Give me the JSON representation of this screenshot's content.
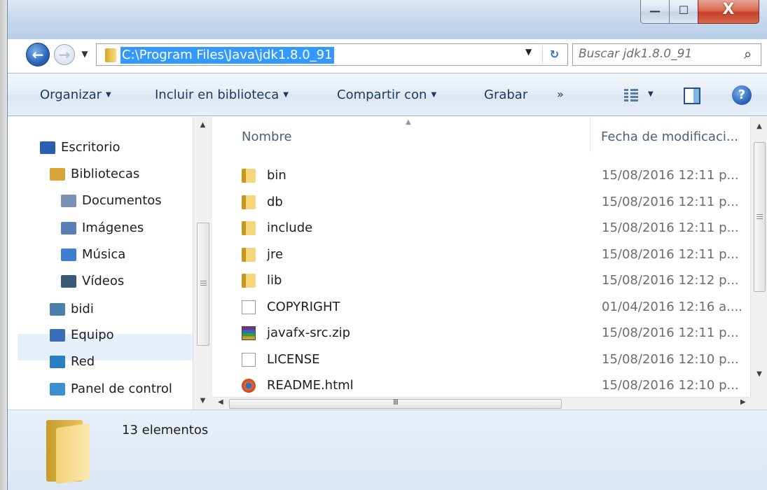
{
  "titlebar": {
    "buttons": {
      "minimize": "—",
      "maximize": "☐",
      "close": "X"
    }
  },
  "nav": {
    "back": "←",
    "forward": "→",
    "address": "C:\\Program Files\\Java\\jdk1.8.0_91",
    "search_placeholder": "Buscar jdk1.8.0_91"
  },
  "commands": {
    "organize": "Organizar",
    "include_library": "Incluir en biblioteca",
    "share_with": "Compartir con",
    "burn": "Grabar",
    "more": "»"
  },
  "navigation_pane": {
    "items": [
      {
        "label": "Escritorio",
        "icon": "desktop-icon",
        "color": "#2a5fb0"
      },
      {
        "label": "Bibliotecas",
        "icon": "libraries-icon",
        "color": "#d9a53a"
      },
      {
        "label": "Documentos",
        "icon": "documents-icon",
        "color": "#7b92b4"
      },
      {
        "label": "Imágenes",
        "icon": "images-icon",
        "color": "#5a7fb8"
      },
      {
        "label": "Música",
        "icon": "music-icon",
        "color": "#3d7fd0"
      },
      {
        "label": "Vídeos",
        "icon": "videos-icon",
        "color": "#3a5a7a"
      },
      {
        "label": "bidi",
        "icon": "user-folder-icon",
        "color": "#4a7fb0"
      },
      {
        "label": "Equipo",
        "icon": "computer-icon",
        "color": "#3a6fb8",
        "selected": true
      },
      {
        "label": "Red",
        "icon": "network-icon",
        "color": "#2a7fc0"
      },
      {
        "label": "Panel de control",
        "icon": "control-panel-icon",
        "color": "#3a8fd0"
      }
    ]
  },
  "file_list": {
    "columns": {
      "name": "Nombre",
      "date": "Fecha de modificaci..."
    },
    "rows": [
      {
        "name": "bin",
        "date": "15/08/2016 12:11 p...",
        "type": "folder"
      },
      {
        "name": "db",
        "date": "15/08/2016 12:11 p...",
        "type": "folder"
      },
      {
        "name": "include",
        "date": "15/08/2016 12:11 p...",
        "type": "folder"
      },
      {
        "name": "jre",
        "date": "15/08/2016 12:11 p...",
        "type": "folder"
      },
      {
        "name": "lib",
        "date": "15/08/2016 12:12 p...",
        "type": "folder"
      },
      {
        "name": "COPYRIGHT",
        "date": "01/04/2016 12:16 a....",
        "type": "file"
      },
      {
        "name": "javafx-src.zip",
        "date": "15/08/2016 12:11 p...",
        "type": "zip"
      },
      {
        "name": "LICENSE",
        "date": "15/08/2016 12:10 p...",
        "type": "file"
      },
      {
        "name": "README.html",
        "date": "15/08/2016 12:10 p...",
        "type": "html"
      }
    ]
  },
  "details": {
    "count": "13 elementos"
  }
}
